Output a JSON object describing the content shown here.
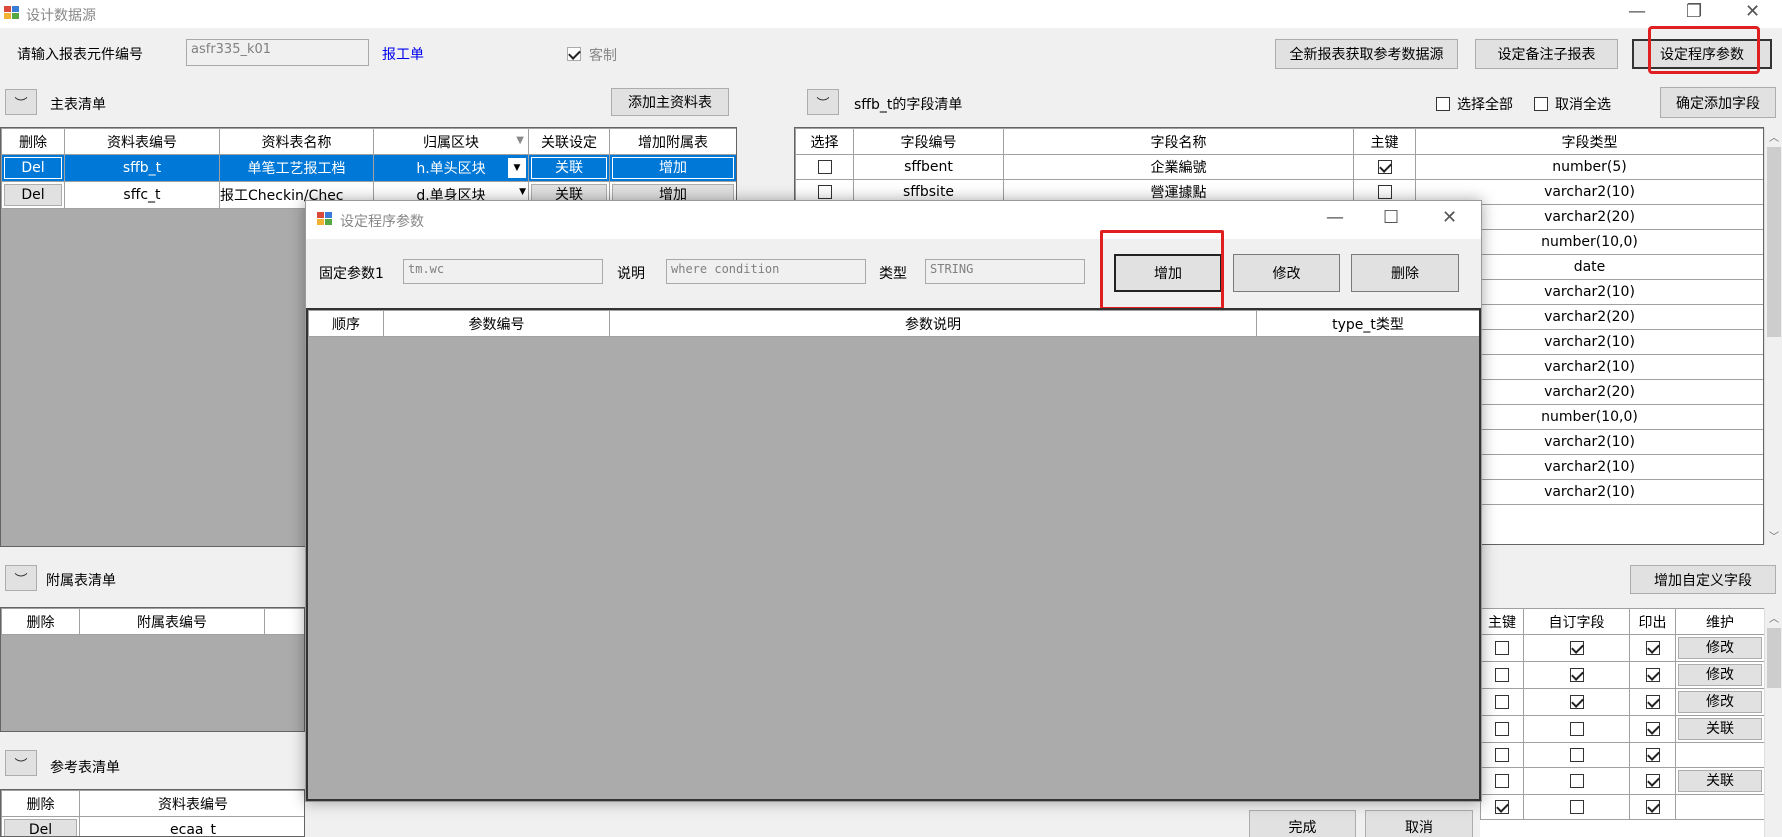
{
  "window": {
    "title": "设计数据源"
  },
  "toolbar": {
    "component_label": "请输入报表元件编号",
    "component_value": "asfr335_k01",
    "report_link": "报工单",
    "custom_label": "客制",
    "btn_new_report": "全新报表获取参考数据源",
    "btn_sub_report": "设定备注子报表",
    "btn_set_params": "设定程序参数"
  },
  "main_list": {
    "title": "主表清单",
    "add_button": "添加主资料表",
    "columns": [
      "删除",
      "资料表编号",
      "资料表名称",
      "归属区块",
      "关联设定",
      "增加附属表"
    ],
    "rows": [
      {
        "del": "Del",
        "id": "sffb_t",
        "name": "单笔工艺报工档",
        "block": "h.单头区块",
        "rel": "关联",
        "add": "增加"
      },
      {
        "del": "Del",
        "id": "sffc_t",
        "name": "报工Checkin/Chec",
        "block": "d.单身区块",
        "rel": "关联",
        "add": "增加"
      }
    ]
  },
  "field_list": {
    "title": "sffb_t的字段清单",
    "select_all": "选择全部",
    "deselect_all": "取消全选",
    "confirm_button": "确定添加字段",
    "columns": [
      "选择",
      "字段编号",
      "字段名称",
      "主键",
      "字段类型"
    ],
    "rows": [
      {
        "id": "sffbent",
        "name": "企業編號",
        "pk": true,
        "type": "number(5)"
      },
      {
        "id": "sffbsite",
        "name": "營運據點",
        "pk": false,
        "type": "varchar2(10)"
      },
      {
        "id": "",
        "name": "",
        "pk": false,
        "type": "varchar2(20)"
      },
      {
        "id": "",
        "name": "",
        "pk": false,
        "type": "number(10,0)"
      },
      {
        "id": "",
        "name": "",
        "pk": false,
        "type": "date"
      },
      {
        "id": "",
        "name": "",
        "pk": false,
        "type": "varchar2(10)"
      },
      {
        "id": "",
        "name": "",
        "pk": false,
        "type": "varchar2(20)"
      },
      {
        "id": "",
        "name": "",
        "pk": false,
        "type": "varchar2(10)"
      },
      {
        "id": "",
        "name": "",
        "pk": false,
        "type": "varchar2(10)"
      },
      {
        "id": "",
        "name": "",
        "pk": false,
        "type": "varchar2(20)"
      },
      {
        "id": "",
        "name": "",
        "pk": false,
        "type": "number(10,0)"
      },
      {
        "id": "",
        "name": "",
        "pk": false,
        "type": "varchar2(10)"
      },
      {
        "id": "",
        "name": "",
        "pk": false,
        "type": "varchar2(10)"
      },
      {
        "id": "",
        "name": "",
        "pk": false,
        "type": "varchar2(10)"
      }
    ]
  },
  "custom_fields": {
    "add_button": "增加自定义字段",
    "columns": [
      "主键",
      "自订字段",
      "印出",
      "维护"
    ],
    "rows": [
      {
        "pk": false,
        "custom": true,
        "print": true,
        "action": "修改"
      },
      {
        "pk": false,
        "custom": true,
        "print": true,
        "action": "修改"
      },
      {
        "pk": false,
        "custom": true,
        "print": true,
        "action": "修改"
      },
      {
        "pk": false,
        "custom": false,
        "print": true,
        "action": "关联"
      },
      {
        "pk": false,
        "custom": false,
        "print": true,
        "action": ""
      },
      {
        "pk": false,
        "custom": false,
        "print": true,
        "action": "关联"
      },
      {
        "pk": true,
        "custom": false,
        "print": true,
        "action": ""
      }
    ]
  },
  "attached_list": {
    "title": "附属表清单",
    "columns": [
      "删除",
      "附属表编号"
    ]
  },
  "ref_list": {
    "title": "参考表清单",
    "columns": [
      "删除",
      "资料表编号"
    ],
    "rows": [
      {
        "del": "Del",
        "id": "ecaa_t"
      }
    ]
  },
  "bottom": {
    "done": "完成",
    "cancel": "取消"
  },
  "dialog": {
    "title": "设定程序参数",
    "fixed_param_label": "固定参数1",
    "fixed_param_value": "tm.wc",
    "desc_label": "说明",
    "desc_value": "where condition",
    "type_label": "类型",
    "type_value": "STRING",
    "btn_add": "增加",
    "btn_modify": "修改",
    "btn_delete": "删除",
    "columns": [
      "顺序",
      "参数编号",
      "参数说明",
      "type_t类型"
    ]
  },
  "colors": {
    "selection": "#0078d7",
    "highlight": "#e02020",
    "link": "#0000ee"
  }
}
